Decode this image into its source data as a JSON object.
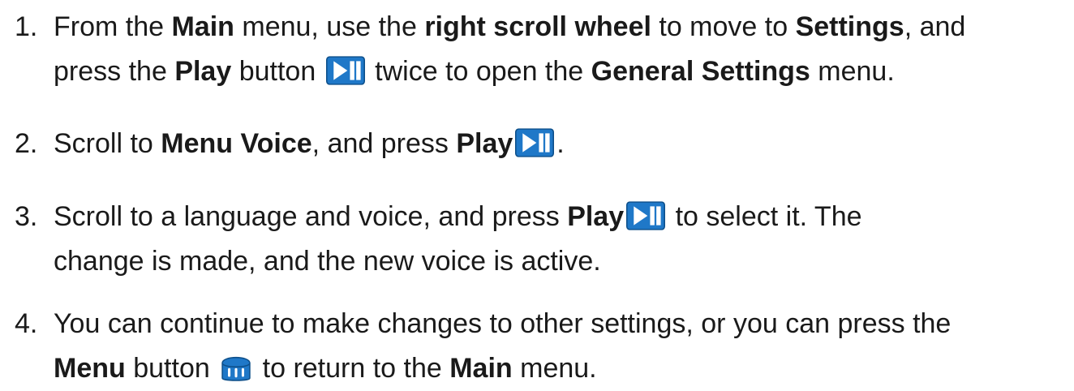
{
  "steps": [
    {
      "number": "1.",
      "line1": {
        "t1": "From the ",
        "b1": "Main",
        "t2": " menu, use the ",
        "b2": "right scroll wheel",
        "t3": " to move to ",
        "b3": "Settings",
        "t4": ", and"
      },
      "line2": {
        "t1": "press the ",
        "b1": "Play",
        "t2": " button ",
        "t3": " twice to open the ",
        "b2": "General Settings",
        "t4": " menu."
      }
    },
    {
      "number": "2.",
      "t1": "Scroll to ",
      "b1": "Menu Voice",
      "t2": ", and press ",
      "b2": "Play",
      "t3": "."
    },
    {
      "number": "3.",
      "line1": {
        "t1": "Scroll to a language and voice, and press ",
        "b1": "Play",
        "t2": " to select it. The"
      },
      "line2": {
        "t1": "change is made, and the new voice is active."
      }
    },
    {
      "number": "4.",
      "line1": {
        "t1": "You can continue to make changes to other settings, or you can press the"
      },
      "line2": {
        "b1": "Menu",
        "t1": " button ",
        "t2": " to return to the ",
        "b2": "Main",
        "t3": " menu."
      }
    }
  ],
  "icons": {
    "play": {
      "name": "play-pause-icon",
      "fill": "#1f78c8",
      "border": "#0d4f8a",
      "glyph": "#ffffff"
    },
    "menu": {
      "name": "menu-knob-icon",
      "fill": "#1f78c8",
      "border": "#0d4f8a",
      "glyph": "#ffffff"
    }
  }
}
